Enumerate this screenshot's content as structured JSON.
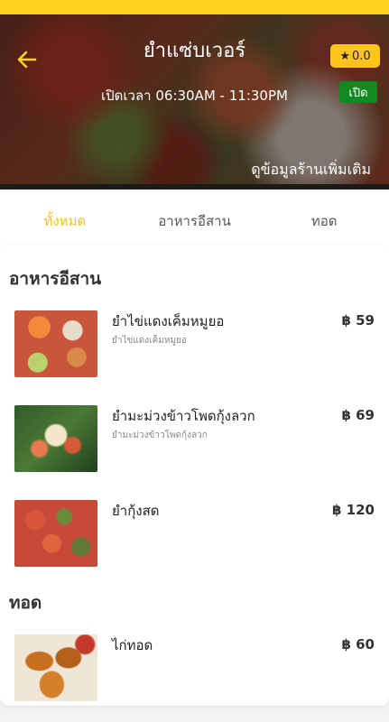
{
  "header": {
    "shop_name": "ยำแซ่บเวอร์",
    "hours": "เปิดเวลา 06:30AM - 11:30PM",
    "rating_star": "★",
    "rating": "0.0",
    "status": "เปิด",
    "more_info": "ดูข้อมูลร้านเพิ่มเติม",
    "colors": {
      "accent": "#ffd21f",
      "open_badge": "#0f8a1f",
      "rating_badge": "#ffc51a"
    }
  },
  "tabs": [
    {
      "label": "ทั้งหมด",
      "active": true
    },
    {
      "label": "อาหารอีสาน",
      "active": false
    },
    {
      "label": "ทอด",
      "active": false
    }
  ],
  "sections": [
    {
      "title": "อาหารอีสาน",
      "items": [
        {
          "name": "ยำไข่แดงเค็มหมูยอ",
          "desc": "ยำไข่แดงเค็มหมูยอ",
          "price": "฿ 59"
        },
        {
          "name": "ยำมะม่วงข้าวโพดกุ้งลวก",
          "desc": "ยำมะม่วงข้าวโพดกุ้งลวก",
          "price": "฿ 69"
        },
        {
          "name": "ยำกุ้งสด",
          "desc": "",
          "price": "฿ 120"
        }
      ]
    },
    {
      "title": "ทอด",
      "items": [
        {
          "name": "ไก่ทอด",
          "desc": "",
          "price": "฿ 60"
        }
      ]
    }
  ]
}
